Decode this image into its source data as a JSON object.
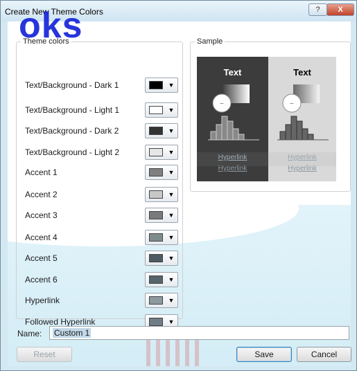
{
  "window": {
    "title": "Create New Theme Colors",
    "help_glyph": "?",
    "close_glyph": "X"
  },
  "watermark": {
    "text": "oks"
  },
  "theme_colors": {
    "legend": "Theme colors",
    "items": [
      {
        "label": "Text/Background - Dark 1",
        "color": "#000000"
      },
      {
        "label": "Text/Background - Light 1",
        "color": "#ffffff"
      },
      {
        "label": "Text/Background - Dark 2",
        "color": "#333333"
      },
      {
        "label": "Text/Background - Light 2",
        "color": "#e6e6e6"
      },
      {
        "label": "Accent 1",
        "color": "#808080"
      },
      {
        "label": "Accent 2",
        "color": "#c8c8c8"
      },
      {
        "label": "Accent 3",
        "color": "#7a7a7a"
      },
      {
        "label": "Accent 4",
        "color": "#7f8c8d"
      },
      {
        "label": "Accent 5",
        "color": "#4d5a62"
      },
      {
        "label": "Accent 6",
        "color": "#56646c"
      },
      {
        "label": "Hyperlink",
        "color": "#8e989f"
      },
      {
        "label": "Followed Hyperlink",
        "color": "#6f7d86"
      }
    ]
  },
  "sample": {
    "legend": "Sample",
    "dark_text": "Text",
    "light_text": "Text",
    "hyperlink": "Hyperlink",
    "followed_hyperlink": "Hyperlink",
    "bubble_text": "~"
  },
  "name_field": {
    "label": "Name:",
    "value": "Custom 1"
  },
  "buttons": {
    "reset": "Reset",
    "save": "Save",
    "cancel": "Cancel"
  }
}
